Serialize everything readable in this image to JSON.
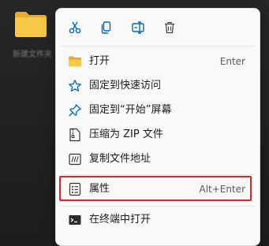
{
  "desktop": {
    "folder_label": "新建文件夹"
  },
  "toolbar": {
    "cut_icon": "cut-icon",
    "copy_icon": "copy-icon",
    "rename_icon": "rename-icon",
    "delete_icon": "trash-icon"
  },
  "menu": {
    "items": [
      {
        "label": "打开",
        "shortcut": "Enter",
        "icon": "folder-icon"
      },
      {
        "label": "固定到快速访问",
        "shortcut": "",
        "icon": "star-icon"
      },
      {
        "label": "固定到“开始”屏幕",
        "shortcut": "",
        "icon": "pin-icon"
      },
      {
        "label": "压缩为 ZIP 文件",
        "shortcut": "",
        "icon": "zip-icon"
      },
      {
        "label": "复制文件地址",
        "shortcut": "",
        "icon": "path-icon"
      },
      {
        "label": "属性",
        "shortcut": "Alt+Enter",
        "icon": "properties-icon"
      },
      {
        "label": "在终端中打开",
        "shortcut": "",
        "icon": "terminal-icon"
      }
    ]
  },
  "colors": {
    "accent": "#0067c0",
    "highlight_border": "#e5202e",
    "folder": "#f4c542"
  }
}
